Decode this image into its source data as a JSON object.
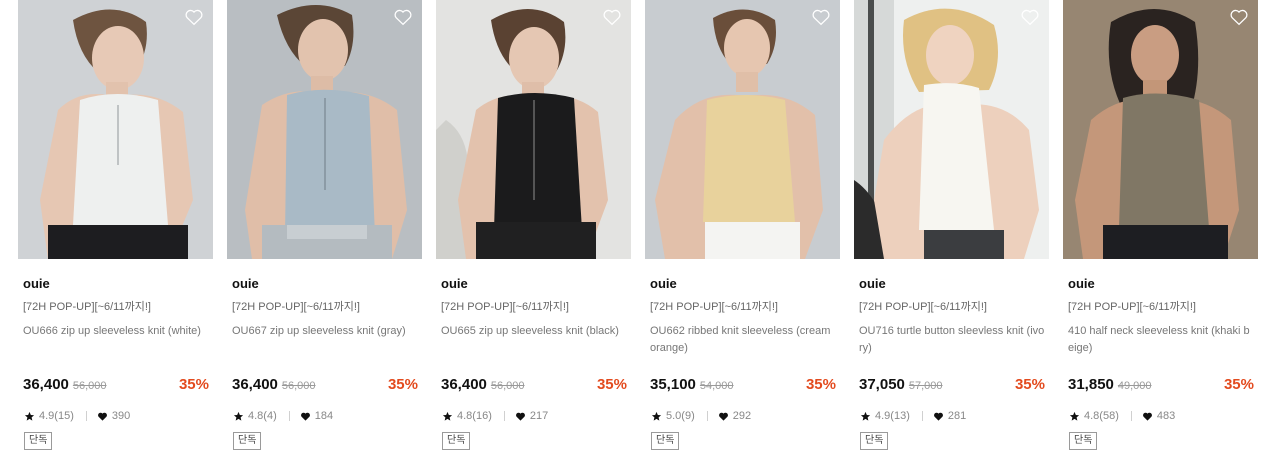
{
  "colors": {
    "discount": "#e34b1f",
    "text": "#111111",
    "muted": "#888888"
  },
  "icons": {
    "wishlist": "heart-outline-icon",
    "rating": "star-icon",
    "likes": "heart-icon"
  },
  "products": [
    {
      "brand": "ouie",
      "promo": "[72H POP-UP][~6/11까지!]",
      "name": "OU666 zip up sleeveless knit (white)",
      "price": "36,400",
      "original_price": "56,000",
      "discount": "35%",
      "rating": "4.9(15)",
      "likes": "390",
      "badge": "단독"
    },
    {
      "brand": "ouie",
      "promo": "[72H POP-UP][~6/11까지!]",
      "name": "OU667 zip up sleeveless knit (gray)",
      "price": "36,400",
      "original_price": "56,000",
      "discount": "35%",
      "rating": "4.8(4)",
      "likes": "184",
      "badge": "단독"
    },
    {
      "brand": "ouie",
      "promo": "[72H POP-UP][~6/11까지!]",
      "name": "OU665 zip up sleeveless knit (black)",
      "price": "36,400",
      "original_price": "56,000",
      "discount": "35%",
      "rating": "4.8(16)",
      "likes": "217",
      "badge": "단독"
    },
    {
      "brand": "ouie",
      "promo": "[72H POP-UP][~6/11까지!]",
      "name": "OU662 ribbed knit sleeveless (cream orange)",
      "price": "35,100",
      "original_price": "54,000",
      "discount": "35%",
      "rating": "5.0(9)",
      "likes": "292",
      "badge": "단독"
    },
    {
      "brand": "ouie",
      "promo": "[72H POP-UP][~6/11까지!]",
      "name": "OU716 turtle button sleevless knit (ivory)",
      "price": "37,050",
      "original_price": "57,000",
      "discount": "35%",
      "rating": "4.9(13)",
      "likes": "281",
      "badge": "단독"
    },
    {
      "brand": "ouie",
      "promo": "[72H POP-UP][~6/11까지!]",
      "name": "410 half neck sleeveless knit (khaki beige)",
      "price": "31,850",
      "original_price": "49,000",
      "discount": "35%",
      "rating": "4.8(58)",
      "likes": "483",
      "badge": "단독"
    }
  ]
}
